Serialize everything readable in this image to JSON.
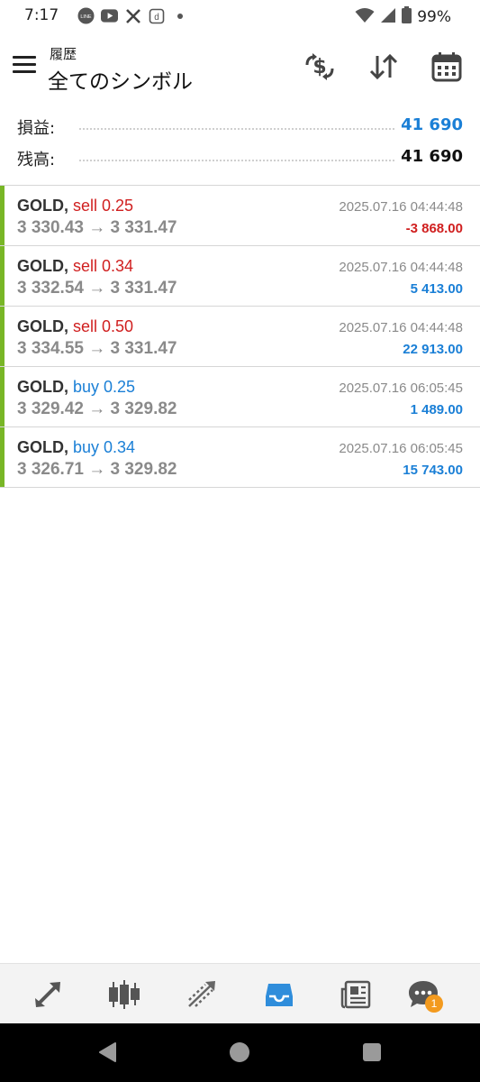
{
  "status_bar": {
    "time": "7:17",
    "battery": "99%",
    "icons": [
      "line-icon",
      "youtube-icon",
      "x-icon",
      "dmagazine-icon",
      "dot-icon",
      "wifi-icon",
      "signal-icon",
      "battery-icon"
    ]
  },
  "header": {
    "subtitle": "履歴",
    "title": "全てのシンボル",
    "buttons": [
      "dollar-exchange-icon",
      "sort-icon",
      "calendar-icon"
    ]
  },
  "summary": {
    "profit_label": "損益:",
    "profit_value": "41 690",
    "balance_label": "残高:",
    "balance_value": "41 690"
  },
  "deals": [
    {
      "symbol": "GOLD,",
      "side": "sell 0.25",
      "prices": "3 330.43 → 3 331.47",
      "datetime": "2025.07.16 04:44:48",
      "profit": "-3 868.00"
    },
    {
      "symbol": "GOLD,",
      "side": "sell 0.34",
      "prices": "3 332.54 → 3 331.47",
      "datetime": "2025.07.16 04:44:48",
      "profit": "5 413.00"
    },
    {
      "symbol": "GOLD,",
      "side": "sell 0.50",
      "prices": "3 334.55 → 3 331.47",
      "datetime": "2025.07.16 04:44:48",
      "profit": "22 913.00"
    },
    {
      "symbol": "GOLD,",
      "side": "buy 0.25",
      "prices": "3 329.42 → 3 329.82",
      "datetime": "2025.07.16 06:05:45",
      "profit": "1 489.00"
    },
    {
      "symbol": "GOLD,",
      "side": "buy 0.34",
      "prices": "3 326.71 → 3 329.82",
      "datetime": "2025.07.16 06:05:45",
      "profit": "15 743.00"
    }
  ],
  "bottom_nav": {
    "items": [
      "quotes-icon",
      "chart-icon",
      "trade-icon",
      "history-icon",
      "news-icon",
      "chat-icon"
    ],
    "chat_badge": "1"
  },
  "colors": {
    "sell": "#d01f1f",
    "buy": "#1a7fd6",
    "profit_positive": "#1a7fd6",
    "profit_negative": "#d01f1f",
    "accent_bar": "#78b626",
    "active_tab": "#2f8ddb"
  }
}
